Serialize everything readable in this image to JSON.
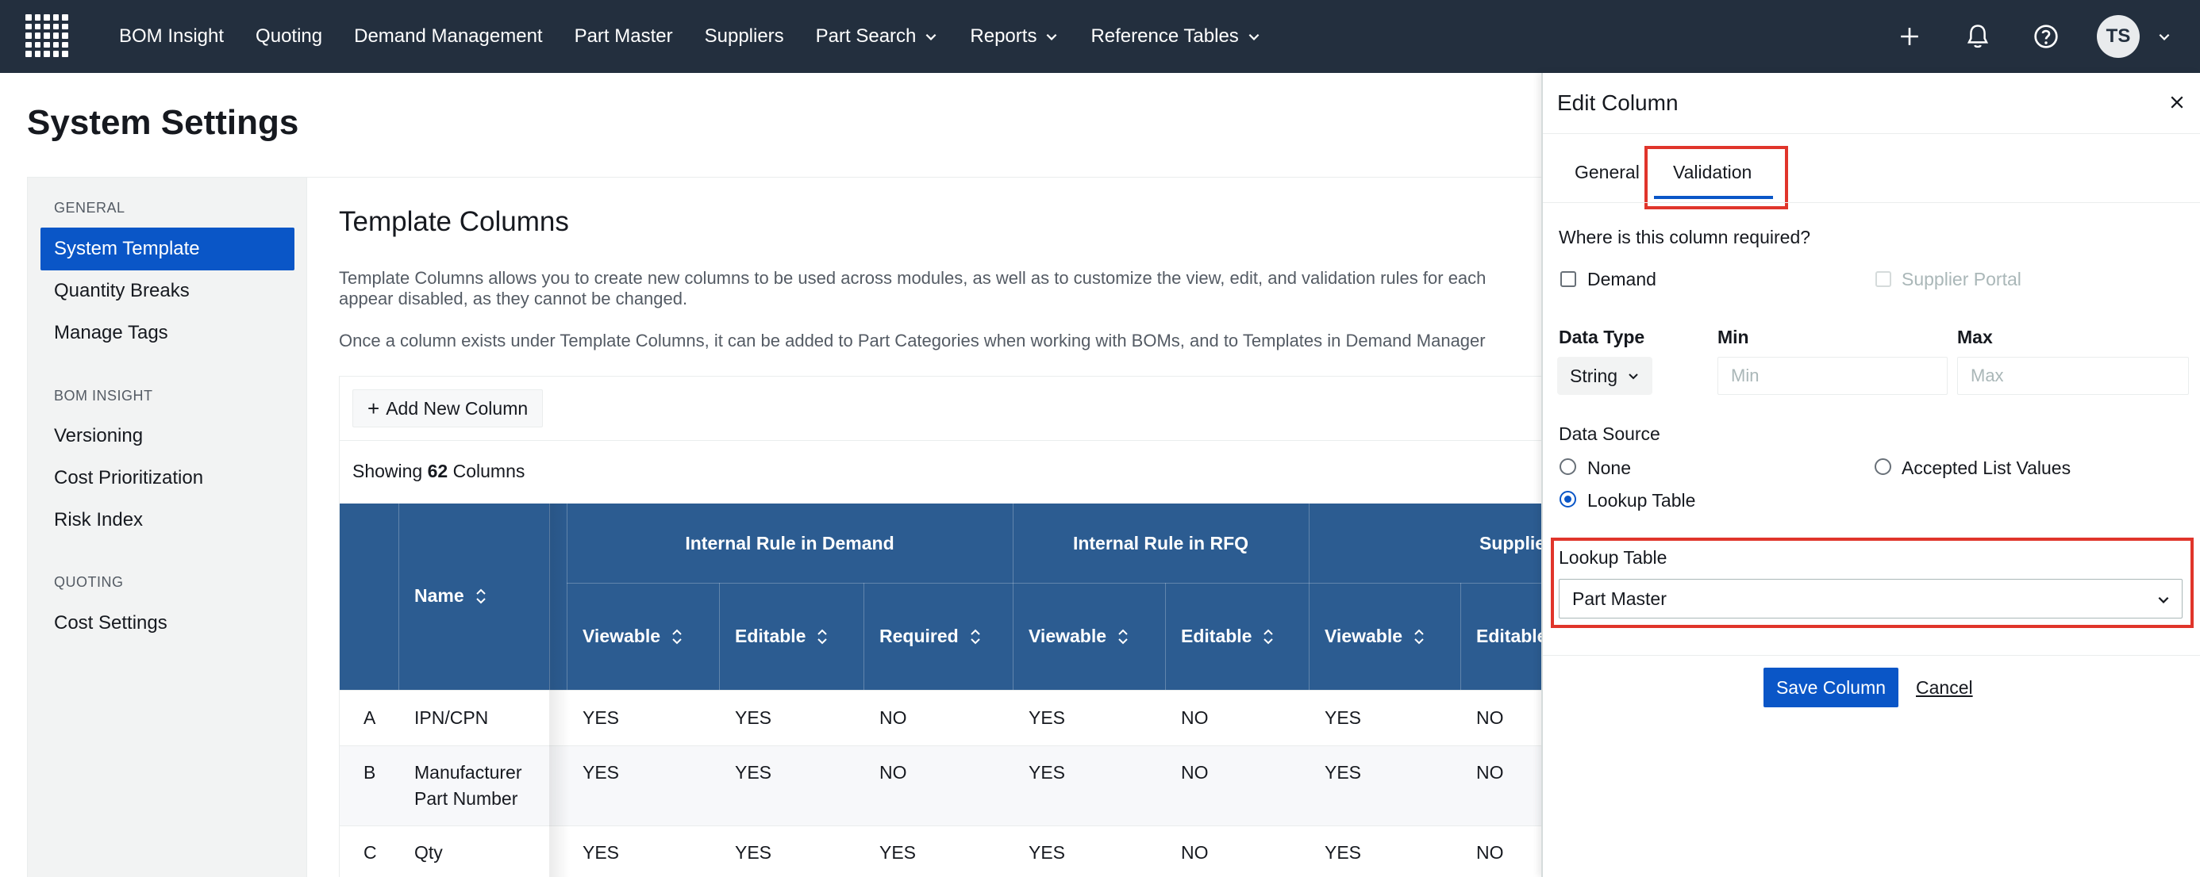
{
  "nav": {
    "items": [
      {
        "label": "BOM Insight",
        "dropdown": false
      },
      {
        "label": "Quoting",
        "dropdown": false
      },
      {
        "label": "Demand Management",
        "dropdown": false
      },
      {
        "label": "Part Master",
        "dropdown": false
      },
      {
        "label": "Suppliers",
        "dropdown": false
      },
      {
        "label": "Part Search",
        "dropdown": true
      },
      {
        "label": "Reports",
        "dropdown": true
      },
      {
        "label": "Reference Tables",
        "dropdown": true
      }
    ],
    "avatar_initials": "TS"
  },
  "page": {
    "title": "System Settings"
  },
  "sidebar": {
    "sections": [
      {
        "label": "GENERAL",
        "items": [
          "System Template",
          "Quantity Breaks",
          "Manage Tags"
        ]
      },
      {
        "label": "BOM INSIGHT",
        "items": [
          "Versioning",
          "Cost Prioritization",
          "Risk Index"
        ]
      },
      {
        "label": "QUOTING",
        "items": [
          "Cost Settings"
        ]
      }
    ],
    "active": "System Template"
  },
  "main": {
    "heading": "Template Columns",
    "desc1": "Template Columns allows you to create new columns to be used across modules, as well as to customize the view, edit, and validation rules for each",
    "desc1b": "appear disabled, as they cannot be changed.",
    "desc2": "Once a column exists under Template Columns, it can be added to Part Categories when working with BOMs, and to Templates in Demand Manager",
    "add_button": "Add New Column",
    "showing_prefix": "Showing ",
    "showing_count": "62",
    "showing_suffix": " Columns"
  },
  "table": {
    "name_header": "Name",
    "groups": [
      "Internal Rule in Demand",
      "Internal Rule in RFQ",
      "Supplier Ru"
    ],
    "subheaders": [
      "Viewable",
      "Editable",
      "Required",
      "Viewable",
      "Editable",
      "Viewable",
      "Editable"
    ],
    "rows": [
      {
        "key": "A",
        "name": "IPN/CPN",
        "name2": "",
        "values": [
          "YES",
          "YES",
          "NO",
          "YES",
          "NO",
          "YES",
          "NO"
        ]
      },
      {
        "key": "B",
        "name": "Manufacturer",
        "name2": "Part Number",
        "values": [
          "YES",
          "YES",
          "NO",
          "YES",
          "NO",
          "YES",
          "NO"
        ]
      },
      {
        "key": "C",
        "name": "Qty",
        "name2": "",
        "values": [
          "YES",
          "YES",
          "YES",
          "YES",
          "NO",
          "YES",
          "NO"
        ]
      }
    ]
  },
  "drawer": {
    "title": "Edit Column",
    "tabs": [
      "General",
      "Validation"
    ],
    "active_tab": "Validation",
    "required_question": "Where is this column required?",
    "required_options": [
      {
        "label": "Demand",
        "checked": false,
        "disabled": false
      },
      {
        "label": "Supplier Portal",
        "checked": false,
        "disabled": true
      }
    ],
    "data_type_label": "Data Type",
    "data_type_value": "String",
    "min_label": "Min",
    "min_placeholder": "Min",
    "max_label": "Max",
    "max_placeholder": "Max",
    "data_source_label": "Data Source",
    "data_source_options": [
      "None",
      "Accepted List Values",
      "Lookup Table"
    ],
    "data_source_selected": "Lookup Table",
    "lookup_table_label": "Lookup Table",
    "lookup_table_value": "Part Master",
    "save_label": "Save Column",
    "cancel_label": "Cancel"
  },
  "colors": {
    "nav_bg": "#232f3e",
    "accent": "#0a56c7",
    "table_header": "#2c5c91",
    "highlight": "#e0352b"
  }
}
